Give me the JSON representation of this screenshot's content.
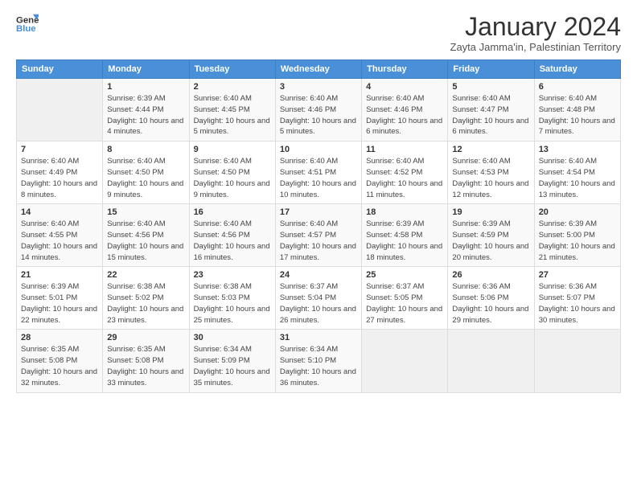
{
  "header": {
    "logo_line1": "General",
    "logo_line2": "Blue",
    "title": "January 2024",
    "subtitle": "Zayta Jamma'in, Palestinian Territory"
  },
  "weekdays": [
    "Sunday",
    "Monday",
    "Tuesday",
    "Wednesday",
    "Thursday",
    "Friday",
    "Saturday"
  ],
  "rows": [
    [
      {
        "day": "",
        "sunrise": "",
        "sunset": "",
        "daylight": ""
      },
      {
        "day": "1",
        "sunrise": "Sunrise: 6:39 AM",
        "sunset": "Sunset: 4:44 PM",
        "daylight": "Daylight: 10 hours and 4 minutes."
      },
      {
        "day": "2",
        "sunrise": "Sunrise: 6:40 AM",
        "sunset": "Sunset: 4:45 PM",
        "daylight": "Daylight: 10 hours and 5 minutes."
      },
      {
        "day": "3",
        "sunrise": "Sunrise: 6:40 AM",
        "sunset": "Sunset: 4:46 PM",
        "daylight": "Daylight: 10 hours and 5 minutes."
      },
      {
        "day": "4",
        "sunrise": "Sunrise: 6:40 AM",
        "sunset": "Sunset: 4:46 PM",
        "daylight": "Daylight: 10 hours and 6 minutes."
      },
      {
        "day": "5",
        "sunrise": "Sunrise: 6:40 AM",
        "sunset": "Sunset: 4:47 PM",
        "daylight": "Daylight: 10 hours and 6 minutes."
      },
      {
        "day": "6",
        "sunrise": "Sunrise: 6:40 AM",
        "sunset": "Sunset: 4:48 PM",
        "daylight": "Daylight: 10 hours and 7 minutes."
      }
    ],
    [
      {
        "day": "7",
        "sunrise": "Sunrise: 6:40 AM",
        "sunset": "Sunset: 4:49 PM",
        "daylight": "Daylight: 10 hours and 8 minutes."
      },
      {
        "day": "8",
        "sunrise": "Sunrise: 6:40 AM",
        "sunset": "Sunset: 4:50 PM",
        "daylight": "Daylight: 10 hours and 9 minutes."
      },
      {
        "day": "9",
        "sunrise": "Sunrise: 6:40 AM",
        "sunset": "Sunset: 4:50 PM",
        "daylight": "Daylight: 10 hours and 9 minutes."
      },
      {
        "day": "10",
        "sunrise": "Sunrise: 6:40 AM",
        "sunset": "Sunset: 4:51 PM",
        "daylight": "Daylight: 10 hours and 10 minutes."
      },
      {
        "day": "11",
        "sunrise": "Sunrise: 6:40 AM",
        "sunset": "Sunset: 4:52 PM",
        "daylight": "Daylight: 10 hours and 11 minutes."
      },
      {
        "day": "12",
        "sunrise": "Sunrise: 6:40 AM",
        "sunset": "Sunset: 4:53 PM",
        "daylight": "Daylight: 10 hours and 12 minutes."
      },
      {
        "day": "13",
        "sunrise": "Sunrise: 6:40 AM",
        "sunset": "Sunset: 4:54 PM",
        "daylight": "Daylight: 10 hours and 13 minutes."
      }
    ],
    [
      {
        "day": "14",
        "sunrise": "Sunrise: 6:40 AM",
        "sunset": "Sunset: 4:55 PM",
        "daylight": "Daylight: 10 hours and 14 minutes."
      },
      {
        "day": "15",
        "sunrise": "Sunrise: 6:40 AM",
        "sunset": "Sunset: 4:56 PM",
        "daylight": "Daylight: 10 hours and 15 minutes."
      },
      {
        "day": "16",
        "sunrise": "Sunrise: 6:40 AM",
        "sunset": "Sunset: 4:56 PM",
        "daylight": "Daylight: 10 hours and 16 minutes."
      },
      {
        "day": "17",
        "sunrise": "Sunrise: 6:40 AM",
        "sunset": "Sunset: 4:57 PM",
        "daylight": "Daylight: 10 hours and 17 minutes."
      },
      {
        "day": "18",
        "sunrise": "Sunrise: 6:39 AM",
        "sunset": "Sunset: 4:58 PM",
        "daylight": "Daylight: 10 hours and 18 minutes."
      },
      {
        "day": "19",
        "sunrise": "Sunrise: 6:39 AM",
        "sunset": "Sunset: 4:59 PM",
        "daylight": "Daylight: 10 hours and 20 minutes."
      },
      {
        "day": "20",
        "sunrise": "Sunrise: 6:39 AM",
        "sunset": "Sunset: 5:00 PM",
        "daylight": "Daylight: 10 hours and 21 minutes."
      }
    ],
    [
      {
        "day": "21",
        "sunrise": "Sunrise: 6:39 AM",
        "sunset": "Sunset: 5:01 PM",
        "daylight": "Daylight: 10 hours and 22 minutes."
      },
      {
        "day": "22",
        "sunrise": "Sunrise: 6:38 AM",
        "sunset": "Sunset: 5:02 PM",
        "daylight": "Daylight: 10 hours and 23 minutes."
      },
      {
        "day": "23",
        "sunrise": "Sunrise: 6:38 AM",
        "sunset": "Sunset: 5:03 PM",
        "daylight": "Daylight: 10 hours and 25 minutes."
      },
      {
        "day": "24",
        "sunrise": "Sunrise: 6:37 AM",
        "sunset": "Sunset: 5:04 PM",
        "daylight": "Daylight: 10 hours and 26 minutes."
      },
      {
        "day": "25",
        "sunrise": "Sunrise: 6:37 AM",
        "sunset": "Sunset: 5:05 PM",
        "daylight": "Daylight: 10 hours and 27 minutes."
      },
      {
        "day": "26",
        "sunrise": "Sunrise: 6:36 AM",
        "sunset": "Sunset: 5:06 PM",
        "daylight": "Daylight: 10 hours and 29 minutes."
      },
      {
        "day": "27",
        "sunrise": "Sunrise: 6:36 AM",
        "sunset": "Sunset: 5:07 PM",
        "daylight": "Daylight: 10 hours and 30 minutes."
      }
    ],
    [
      {
        "day": "28",
        "sunrise": "Sunrise: 6:35 AM",
        "sunset": "Sunset: 5:08 PM",
        "daylight": "Daylight: 10 hours and 32 minutes."
      },
      {
        "day": "29",
        "sunrise": "Sunrise: 6:35 AM",
        "sunset": "Sunset: 5:08 PM",
        "daylight": "Daylight: 10 hours and 33 minutes."
      },
      {
        "day": "30",
        "sunrise": "Sunrise: 6:34 AM",
        "sunset": "Sunset: 5:09 PM",
        "daylight": "Daylight: 10 hours and 35 minutes."
      },
      {
        "day": "31",
        "sunrise": "Sunrise: 6:34 AM",
        "sunset": "Sunset: 5:10 PM",
        "daylight": "Daylight: 10 hours and 36 minutes."
      },
      {
        "day": "",
        "sunrise": "",
        "sunset": "",
        "daylight": ""
      },
      {
        "day": "",
        "sunrise": "",
        "sunset": "",
        "daylight": ""
      },
      {
        "day": "",
        "sunrise": "",
        "sunset": "",
        "daylight": ""
      }
    ]
  ]
}
